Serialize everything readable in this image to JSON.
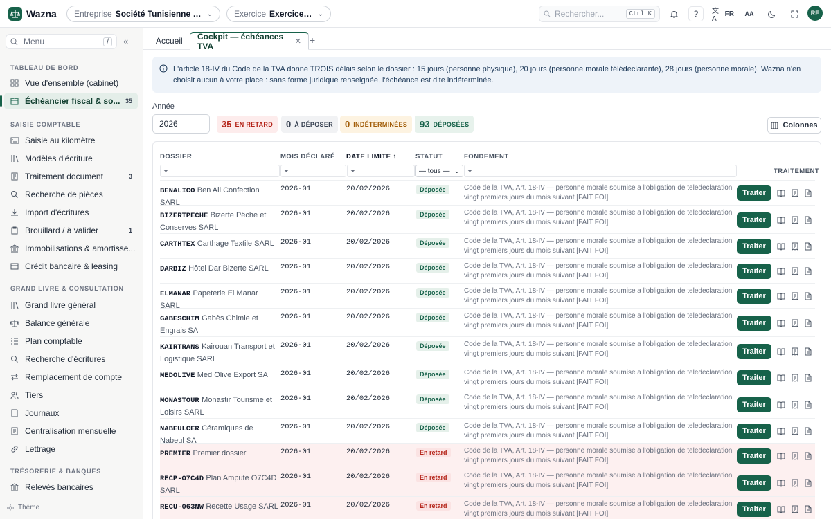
{
  "app": {
    "name": "Wazna"
  },
  "topbar": {
    "entreprise_label": "Entreprise",
    "entreprise_value": "Société Tunisienne de Pla...",
    "exercice_label": "Exercice",
    "exercice_value": "Exercice 2026",
    "search_placeholder": "Rechercher...",
    "search_shortcut": "Ctrl K",
    "help": "?",
    "lang": "FR",
    "font_size": "AA",
    "user_initials": "RE"
  },
  "sidebar": {
    "search_placeholder": "Menu",
    "search_shortcut": "/",
    "theme_label": "Thème",
    "sections": [
      {
        "title": "TABLEAU DE BORD",
        "items": [
          {
            "label": "Vue d'ensemble (cabinet)",
            "icon": "grid-icon"
          },
          {
            "label": "Échéancier fiscal & so...",
            "icon": "calendar-icon",
            "count": "35",
            "active": true
          }
        ]
      },
      {
        "title": "SAISIE COMPTABLE",
        "items": [
          {
            "label": "Saisie au kilomètre",
            "icon": "keyboard-icon"
          },
          {
            "label": "Modèles d'écriture",
            "icon": "library-icon"
          },
          {
            "label": "Traitement document",
            "icon": "document-icon",
            "count": "3"
          },
          {
            "label": "Recherche de pièces",
            "icon": "search-icon"
          },
          {
            "label": "Import d'écritures",
            "icon": "import-icon"
          },
          {
            "label": "Brouillard / à valider",
            "icon": "clipboard-icon",
            "count": "1"
          },
          {
            "label": "Immobilisations & amortisse...",
            "icon": "bank-icon"
          },
          {
            "label": "Crédit bancaire & leasing",
            "icon": "card-icon"
          }
        ]
      },
      {
        "title": "GRAND LIVRE & CONSULTATION",
        "items": [
          {
            "label": "Grand livre général",
            "icon": "library-icon"
          },
          {
            "label": "Balance générale",
            "icon": "scale-icon"
          },
          {
            "label": "Plan comptable",
            "icon": "list-icon"
          },
          {
            "label": "Recherche d'écritures",
            "icon": "search-icon"
          },
          {
            "label": "Remplacement de compte",
            "icon": "swap-icon"
          },
          {
            "label": "Tiers",
            "icon": "users-icon"
          },
          {
            "label": "Journaux",
            "icon": "book-icon"
          },
          {
            "label": "Centralisation mensuelle",
            "icon": "document-icon"
          },
          {
            "label": "Lettrage",
            "icon": "link-icon"
          }
        ]
      },
      {
        "title": "TRÉSORERIE & BANQUES",
        "items": [
          {
            "label": "Relevés bancaires",
            "icon": "bank-icon"
          }
        ]
      }
    ]
  },
  "tabs": [
    {
      "label": "Accueil"
    },
    {
      "label": "Cockpit — échéances TVA",
      "active": true
    }
  ],
  "info_text": "L'article 18-IV du Code de la TVA donne TROIS délais selon le dossier : 15 jours (personne physique), 20 jours (personne morale télédéclarante), 28 jours (personne morale). Wazna n'en choisit aucun à votre place : sans forme juridique renseignée, l'échéance est dite indéterminée.",
  "filters": {
    "year_label": "Année",
    "year_value": "2026",
    "badges": [
      {
        "count": "35",
        "label": "EN RETARD",
        "color": "#b42318",
        "bg": "#fdecec"
      },
      {
        "count": "0",
        "label": "À DÉPOSER",
        "color": "#374151",
        "bg": "#f1f2f4"
      },
      {
        "count": "0",
        "label": "INDÉTERMINÉES",
        "color": "#a15c07",
        "bg": "#fdf3e1"
      },
      {
        "count": "93",
        "label": "DÉPOSÉES",
        "color": "#17624a",
        "bg": "#e7f2ec"
      }
    ],
    "columns_button": "Colonnes"
  },
  "table": {
    "headers": {
      "dossier": "DOSSIER",
      "mois": "MOIS DÉCLARÉ",
      "date": "DATE LIMITE",
      "statut": "STATUT",
      "fondement": "FONDEMENT",
      "traitement": "TRAITEMENT"
    },
    "status_filter": "— tous —",
    "action_label": "Traiter",
    "rows": [
      {
        "code": "BENALICO",
        "name": "Ben Ali Confection SARL",
        "mois": "2026-01",
        "date": "20/02/2026",
        "statut": "Déposée",
        "fondement": "Code de la TVA, Art. 18-IV — personne morale soumise a l'obligation de teledeclaration : vingt premiers jours du mois suivant [FAIT FOI]"
      },
      {
        "code": "BIZERTPECHE",
        "name": "Bizerte Pêche et Conserves SARL",
        "mois": "2026-01",
        "date": "20/02/2026",
        "statut": "Déposée",
        "fondement": "Code de la TVA, Art. 18-IV — personne morale soumise a l'obligation de teledeclaration : vingt premiers jours du mois suivant [FAIT FOI]"
      },
      {
        "code": "CARTHTEX",
        "name": "Carthage Textile SARL",
        "mois": "2026-01",
        "date": "20/02/2026",
        "statut": "Déposée",
        "fondement": "Code de la TVA, Art. 18-IV — personne morale soumise a l'obligation de teledeclaration : vingt premiers jours du mois suivant [FAIT FOI]"
      },
      {
        "code": "DARBIZ",
        "name": "Hôtel Dar Bizerte SARL",
        "mois": "2026-01",
        "date": "20/02/2026",
        "statut": "Déposée",
        "fondement": "Code de la TVA, Art. 18-IV — personne morale soumise a l'obligation de teledeclaration : vingt premiers jours du mois suivant [FAIT FOI]"
      },
      {
        "code": "ELMANAR",
        "name": "Papeterie El Manar SARL",
        "mois": "2026-01",
        "date": "20/02/2026",
        "statut": "Déposée",
        "fondement": "Code de la TVA, Art. 18-IV — personne morale soumise a l'obligation de teledeclaration : vingt premiers jours du mois suivant [FAIT FOI]"
      },
      {
        "code": "GABESCHIM",
        "name": "Gabès Chimie et Engrais SA",
        "mois": "2026-01",
        "date": "20/02/2026",
        "statut": "Déposée",
        "fondement": "Code de la TVA, Art. 18-IV — personne morale soumise a l'obligation de teledeclaration : vingt premiers jours du mois suivant [FAIT FOI]"
      },
      {
        "code": "KAIRTRANS",
        "name": "Kairouan Transport et Logistique SARL",
        "mois": "2026-01",
        "date": "20/02/2026",
        "statut": "Déposée",
        "fondement": "Code de la TVA, Art. 18-IV — personne morale soumise a l'obligation de teledeclaration : vingt premiers jours du mois suivant [FAIT FOI]"
      },
      {
        "code": "MEDOLIVE",
        "name": "Med Olive Export SA",
        "mois": "2026-01",
        "date": "20/02/2026",
        "statut": "Déposée",
        "fondement": "Code de la TVA, Art. 18-IV — personne morale soumise a l'obligation de teledeclaration : vingt premiers jours du mois suivant [FAIT FOI]"
      },
      {
        "code": "MONASTOUR",
        "name": "Monastir Tourisme et Loisirs SARL",
        "mois": "2026-01",
        "date": "20/02/2026",
        "statut": "Déposée",
        "fondement": "Code de la TVA, Art. 18-IV — personne morale soumise a l'obligation de teledeclaration : vingt premiers jours du mois suivant [FAIT FOI]"
      },
      {
        "code": "NABEULCER",
        "name": "Céramiques de Nabeul SA",
        "mois": "2026-01",
        "date": "20/02/2026",
        "statut": "Déposée",
        "fondement": "Code de la TVA, Art. 18-IV — personne morale soumise a l'obligation de teledeclaration : vingt premiers jours du mois suivant [FAIT FOI]"
      },
      {
        "code": "PREMIER",
        "name": "Premier dossier",
        "mois": "2026-01",
        "date": "20/02/2026",
        "statut": "En retard",
        "fondement": "Code de la TVA, Art. 18-IV — personne morale soumise a l'obligation de teledeclaration : vingt premiers jours du mois suivant [FAIT FOI]"
      },
      {
        "code": "RECP-O7C4D",
        "name": "Plan Amputé O7C4D SARL",
        "mois": "2026-01",
        "date": "20/02/2026",
        "statut": "En retard",
        "fondement": "Code de la TVA, Art. 18-IV — personne morale soumise a l'obligation de teledeclaration : vingt premiers jours du mois suivant [FAIT FOI]"
      },
      {
        "code": "RECU-063NW",
        "name": "Recette Usage SARL",
        "mois": "2026-01",
        "date": "20/02/2026",
        "statut": "En retard",
        "fondement": "Code de la TVA, Art. 18-IV — personne morale soumise a l'obligation de teledeclaration : vingt premiers jours du mois suivant [FAIT FOI]"
      }
    ]
  }
}
